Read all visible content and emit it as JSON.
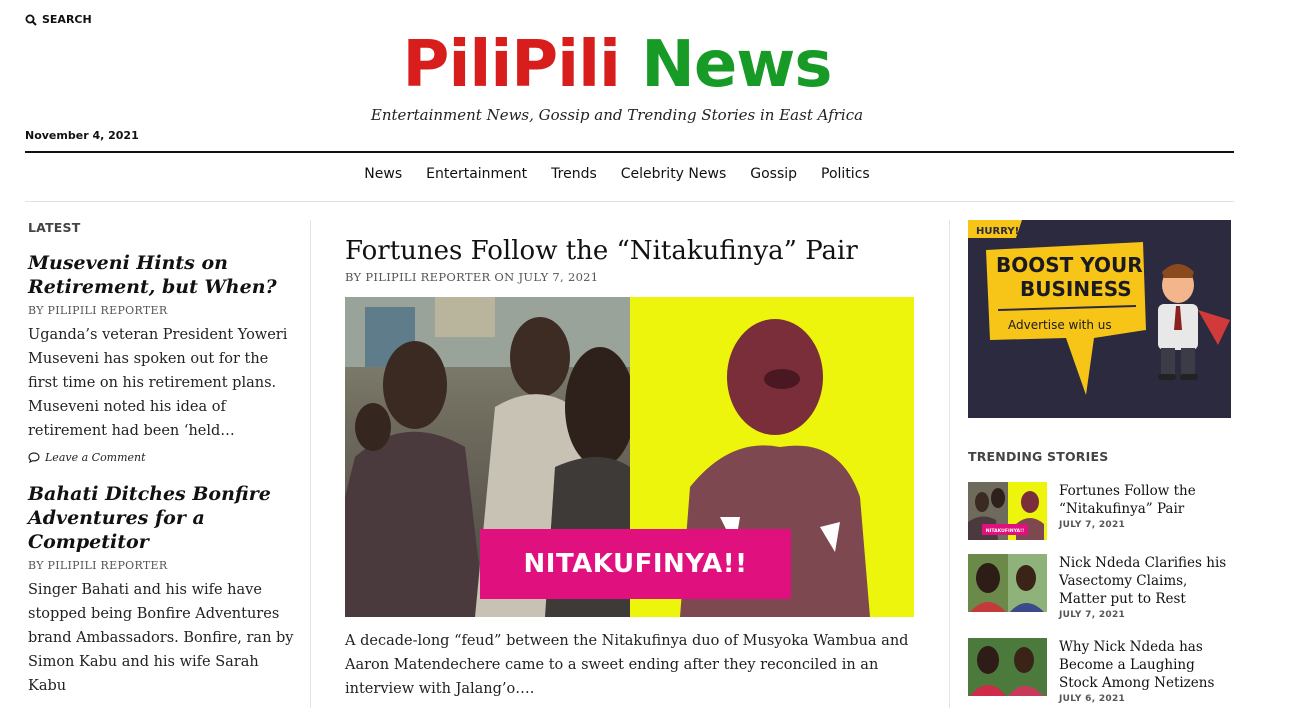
{
  "header": {
    "search_label": "SEARCH",
    "logo_part1": "PiliPili",
    "logo_part2": "News",
    "tagline": "Entertainment News, Gossip and Trending Stories in East Africa",
    "date": "November 4, 2021"
  },
  "nav": {
    "items": [
      "News",
      "Entertainment",
      "Trends",
      "Celebrity News",
      "Gossip",
      "Politics"
    ]
  },
  "latest": {
    "heading": "LATEST",
    "posts": [
      {
        "title": "Museveni Hints on Retirement, but When?",
        "byline": "BY PILIPILI REPORTER",
        "excerpt": "Uganda’s veteran President Yoweri Museveni has spoken out for the first time on his retirement plans. Museveni noted his idea of retirement had been ‘held…",
        "comment": "Leave a Comment"
      },
      {
        "title": "Bahati Ditches Bonfire Adventures for a Competitor",
        "byline": "BY PILIPILI REPORTER",
        "excerpt": "Singer Bahati and his wife have stopped being Bonfire Adventures brand Ambassadors. Bonfire, ran by Simon Kabu and his wife Sarah Kabu"
      }
    ]
  },
  "featured": {
    "title": "Fortunes Follow the “Nitakufinya” Pair",
    "byline": "BY PILIPILI REPORTER ON JULY 7, 2021",
    "image_banner": "NITAKUFINYA!!",
    "excerpt": "A decade-long “feud” between the Nitakufinya duo of Musyoka Wambua and Aaron Matendechere came to a sweet ending after they reconciled in an interview with Jalang’o…."
  },
  "ad": {
    "hurry": "HURRY!",
    "line1": "BOOST YOUR",
    "line2": "BUSINESS",
    "line3": "Advertise with us"
  },
  "trending": {
    "heading": "TRENDING STORIES",
    "items": [
      {
        "title": "Fortunes Follow the “Nitakufinya” Pair",
        "date": "JULY 7, 2021",
        "thumb_label": "NITAKUFINYA!!"
      },
      {
        "title": "Nick Ndeda Clarifies his Vasectomy Claims, Matter put to Rest",
        "date": "JULY 7, 2021"
      },
      {
        "title": "Why Nick Ndeda has Become a Laughing Stock Among Netizens",
        "date": "JULY 6, 2021"
      }
    ]
  },
  "colors": {
    "logo_red": "#d81d1d",
    "logo_green": "#189a26",
    "banner_pink": "#e0117f",
    "image_yellow": "#eef50c",
    "ad_yellow": "#f6c518",
    "ad_dark": "#2b2a3e"
  }
}
